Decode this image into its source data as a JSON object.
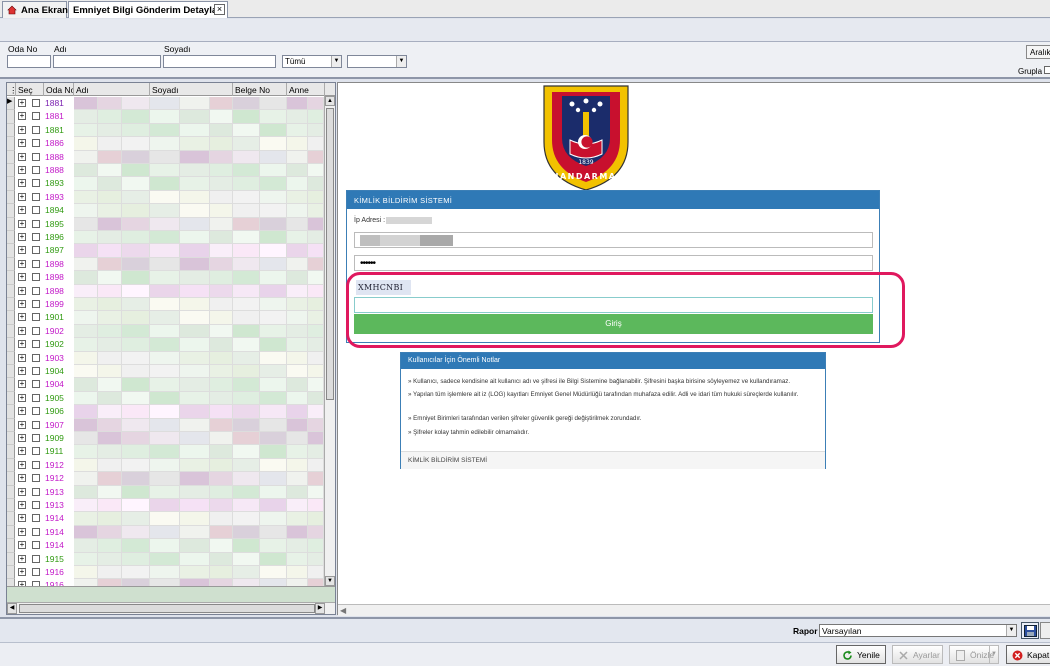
{
  "tabs": [
    {
      "label": "Ana Ekran"
    },
    {
      "label": "Emniyet Bilgi Gönderim Detayları"
    }
  ],
  "filters": {
    "oda_no_label": "Oda No",
    "adi_label": "Adı",
    "soyadi_label": "Soyadı",
    "status_select": "Tümü",
    "aralik_button": "Aralık",
    "grupla_label": "Grupla"
  },
  "grid": {
    "columns": [
      "Seç",
      "Oda No",
      "Adı",
      "Soyadı",
      "Belge No",
      "Anne"
    ],
    "rows": [
      {
        "oda_no": "1881",
        "color": "#7a1fb0"
      },
      {
        "oda_no": "1881",
        "color": "#c218c8"
      },
      {
        "oda_no": "1881",
        "color": "#2f9a10"
      },
      {
        "oda_no": "1886",
        "color": "#c218c8"
      },
      {
        "oda_no": "1888",
        "color": "#c218c8"
      },
      {
        "oda_no": "1888",
        "color": "#c218c8"
      },
      {
        "oda_no": "1893",
        "color": "#2f9a10"
      },
      {
        "oda_no": "1893",
        "color": "#c218c8"
      },
      {
        "oda_no": "1894",
        "color": "#2f9a10"
      },
      {
        "oda_no": "1895",
        "color": "#2f9a10"
      },
      {
        "oda_no": "1896",
        "color": "#2f9a10"
      },
      {
        "oda_no": "1897",
        "color": "#2f9a10"
      },
      {
        "oda_no": "1898",
        "color": "#c218c8"
      },
      {
        "oda_no": "1898",
        "color": "#c218c8"
      },
      {
        "oda_no": "1898",
        "color": "#c218c8"
      },
      {
        "oda_no": "1899",
        "color": "#c218c8"
      },
      {
        "oda_no": "1901",
        "color": "#2f9a10"
      },
      {
        "oda_no": "1902",
        "color": "#c218c8"
      },
      {
        "oda_no": "1902",
        "color": "#2f9a10"
      },
      {
        "oda_no": "1903",
        "color": "#c218c8"
      },
      {
        "oda_no": "1904",
        "color": "#2f9a10"
      },
      {
        "oda_no": "1904",
        "color": "#c218c8"
      },
      {
        "oda_no": "1905",
        "color": "#2f9a10"
      },
      {
        "oda_no": "1906",
        "color": "#2f9a10"
      },
      {
        "oda_no": "1907",
        "color": "#c218c8"
      },
      {
        "oda_no": "1909",
        "color": "#2f9a10"
      },
      {
        "oda_no": "1911",
        "color": "#2f9a10"
      },
      {
        "oda_no": "1912",
        "color": "#c218c8"
      },
      {
        "oda_no": "1912",
        "color": "#c218c8"
      },
      {
        "oda_no": "1913",
        "color": "#c218c8"
      },
      {
        "oda_no": "1913",
        "color": "#c218c8"
      },
      {
        "oda_no": "1914",
        "color": "#c218c8"
      },
      {
        "oda_no": "1914",
        "color": "#c218c8"
      },
      {
        "oda_no": "1914",
        "color": "#c218c8"
      },
      {
        "oda_no": "1915",
        "color": "#2f9a10"
      },
      {
        "oda_no": "1916",
        "color": "#c218c8"
      },
      {
        "oda_no": "1916",
        "color": "#c218c8"
      }
    ]
  },
  "login": {
    "header": "KİMLİK BİLDİRİM SİSTEMİ",
    "ip_label": "İp Adresi :",
    "password_mask": "••••••",
    "captcha_text": "XMHCNBI",
    "submit_label": "Giriş"
  },
  "notes": {
    "header": "Kullanıcılar İçin Önemli Notlar",
    "items": [
      "» Kullanıcı, sadece kendisine ait kullanıcı adı ve şifresi ile Bilgi Sistemine bağlanabilir. Şifresini başka birisine söyleyemez ve kullandıramaz.",
      "» Yapılan tüm işlemlere ait iz (LOG) kayıtları Emniyet Genel Müdürlüğü tarafından muhafaza edilir. Adli ve idari tüm hukuki süreçlerde kullanılır.",
      "» Emniyet Birimleri tarafından verilen şifreler güvenlik gereği değiştirilmek zorundadır.",
      "» Şifreler kolay tahmin edilebilir olmamalıdır."
    ],
    "footer": "KİMLİK BİLDİRİM SİSTEMİ"
  },
  "emblem": {
    "year": "1839",
    "text": "JANDARMA"
  },
  "rapor": {
    "label": "Rapor",
    "selected": "Varsayılan"
  },
  "buttons": {
    "yenile": "Yenile",
    "ayarlar": "Ayarlar",
    "onizle": "Önizle",
    "kapat": "Kapat"
  }
}
